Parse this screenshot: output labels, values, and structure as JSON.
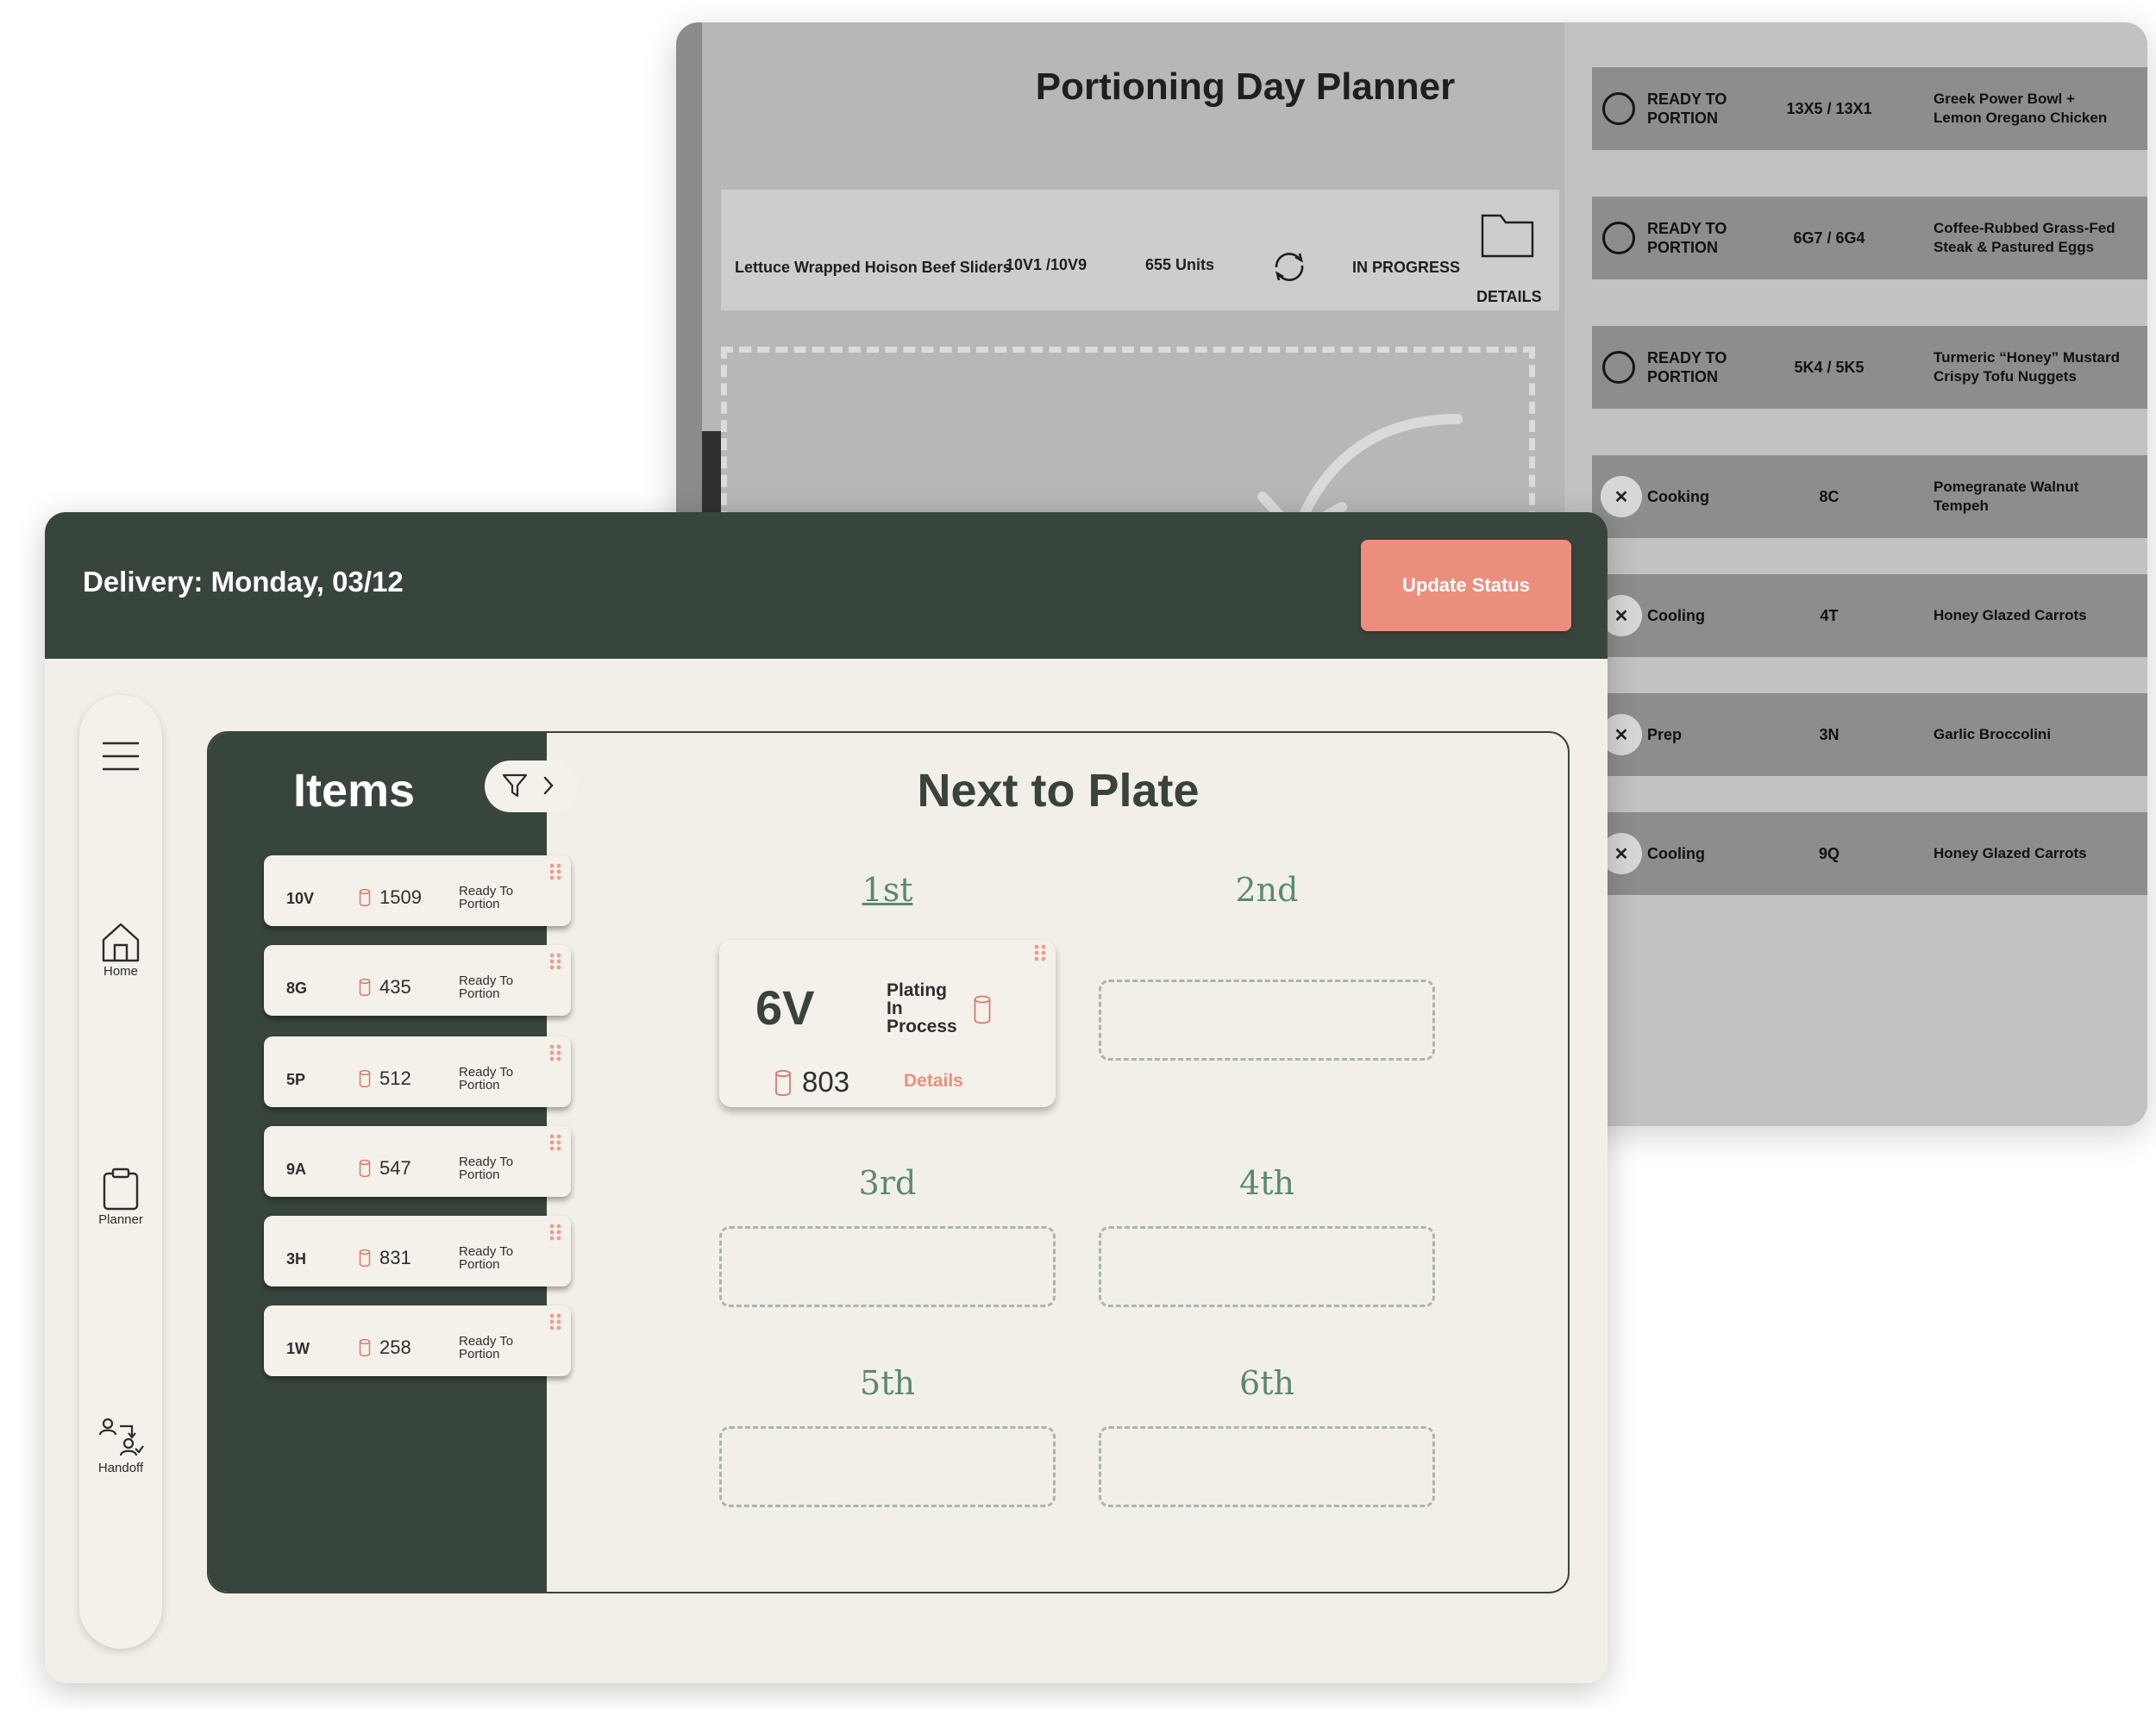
{
  "planner": {
    "title": "Portioning Day Planner",
    "current": {
      "name": "Lettuce Wrapped Hoison Beef Sliders",
      "code": "10V1 /10V9",
      "units": "655 Units",
      "status": "IN PROGRESS",
      "details_label": "DETAILS"
    },
    "queue": [
      {
        "state": "ring",
        "status_lines": [
          "READY TO",
          "PORTION"
        ],
        "code": "13X5 / 13X1",
        "item_lines": [
          "Greek Power Bowl +",
          "Lemon Oregano Chicken"
        ]
      },
      {
        "state": "ring",
        "status_lines": [
          "READY TO",
          "PORTION"
        ],
        "code": "6G7 / 6G4",
        "item_lines": [
          "Coffee-Rubbed Grass-Fed",
          "Steak & Pastured Eggs"
        ]
      },
      {
        "state": "ring",
        "status_lines": [
          "READY TO",
          "PORTION"
        ],
        "code": "5K4 / 5K5",
        "item_lines": [
          "Turmeric “Honey” Mustard",
          "Crispy Tofu Nuggets"
        ]
      },
      {
        "state": "x",
        "x_glyph": "✕",
        "status_lines": [
          "Cooking"
        ],
        "code": "8C",
        "item_lines": [
          "Pomegranate Walnut",
          "Tempeh"
        ]
      },
      {
        "state": "x",
        "x_glyph": "✕",
        "status_lines": [
          "Cooling"
        ],
        "code": "4T",
        "item_lines": [
          "Honey Glazed Carrots"
        ]
      },
      {
        "state": "x",
        "x_glyph": "✕",
        "status_lines": [
          "Prep"
        ],
        "code": "3N",
        "item_lines": [
          "Garlic Broccolini"
        ]
      },
      {
        "state": "x",
        "x_glyph": "✕",
        "status_lines": [
          "Cooling"
        ],
        "code": "9Q",
        "item_lines": [
          "Honey Glazed Carrots"
        ]
      }
    ]
  },
  "app": {
    "header": {
      "title": "Delivery: Monday, 03/12",
      "update_button": "Update Status"
    },
    "colors": {
      "header_bg": "#38453c",
      "accent": "#ec8e7d",
      "background": "#f2efe8",
      "slot_green": "#5a8a6c"
    },
    "sidebar": [
      {
        "label": "Home",
        "icon": "home-icon"
      },
      {
        "label": "Planner",
        "icon": "clipboard-icon"
      },
      {
        "label": "Handoff",
        "icon": "handoff-icon"
      }
    ],
    "items_panel": {
      "title": "Items",
      "items": [
        {
          "code": "10V",
          "count": "1509",
          "status_lines": [
            "Ready To",
            "Portion"
          ]
        },
        {
          "code": "8G",
          "count": "435",
          "status_lines": [
            "Ready To",
            "Portion"
          ]
        },
        {
          "code": "5P",
          "count": "512",
          "status_lines": [
            "Ready To",
            "Portion"
          ]
        },
        {
          "code": "9A",
          "count": "547",
          "status_lines": [
            "Ready To",
            "Portion"
          ]
        },
        {
          "code": "3H",
          "count": "831",
          "status_lines": [
            "Ready To",
            "Portion"
          ]
        },
        {
          "code": "1W",
          "count": "258",
          "status_lines": [
            "Ready To",
            "Portion"
          ]
        }
      ]
    },
    "next_to_plate": {
      "title": "Next to Plate",
      "slots": [
        "1st",
        "2nd",
        "3rd",
        "4th",
        "5th",
        "6th"
      ],
      "active": {
        "code": "6V",
        "status_lines": [
          "Plating",
          "In",
          "Process"
        ],
        "count": "803",
        "details_label": "Details"
      }
    }
  }
}
